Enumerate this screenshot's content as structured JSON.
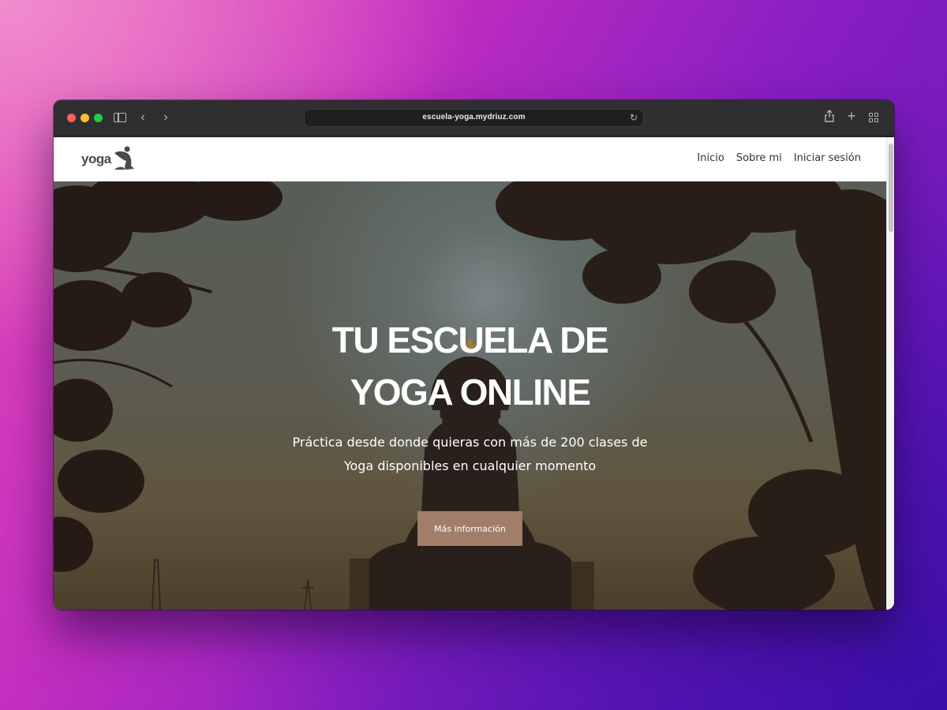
{
  "browser": {
    "url": "escuela-yoga.mydriuz.com",
    "icons": [
      "sidebar-icon",
      "back-icon",
      "forward-icon",
      "reload-icon",
      "share-icon",
      "new-tab-icon",
      "tab-overview-icon"
    ]
  },
  "site": {
    "logo_text": "yoga",
    "nav": [
      "Inicio",
      "Sobre mi",
      "Iniciar sesión"
    ]
  },
  "hero": {
    "title_line1": "TU ESCUELA DE",
    "title_line2": "YOGA ONLINE",
    "subtitle_line1": "Práctica desde donde quieras con más de 200 clases de",
    "subtitle_line2": "Yoga disponibles en cualquier momento",
    "cta_label": "Más información"
  },
  "colors": {
    "cta": "#a07e6a",
    "traffic_red": "#ff5f57",
    "traffic_yellow": "#febc2e",
    "traffic_green": "#28c840"
  }
}
